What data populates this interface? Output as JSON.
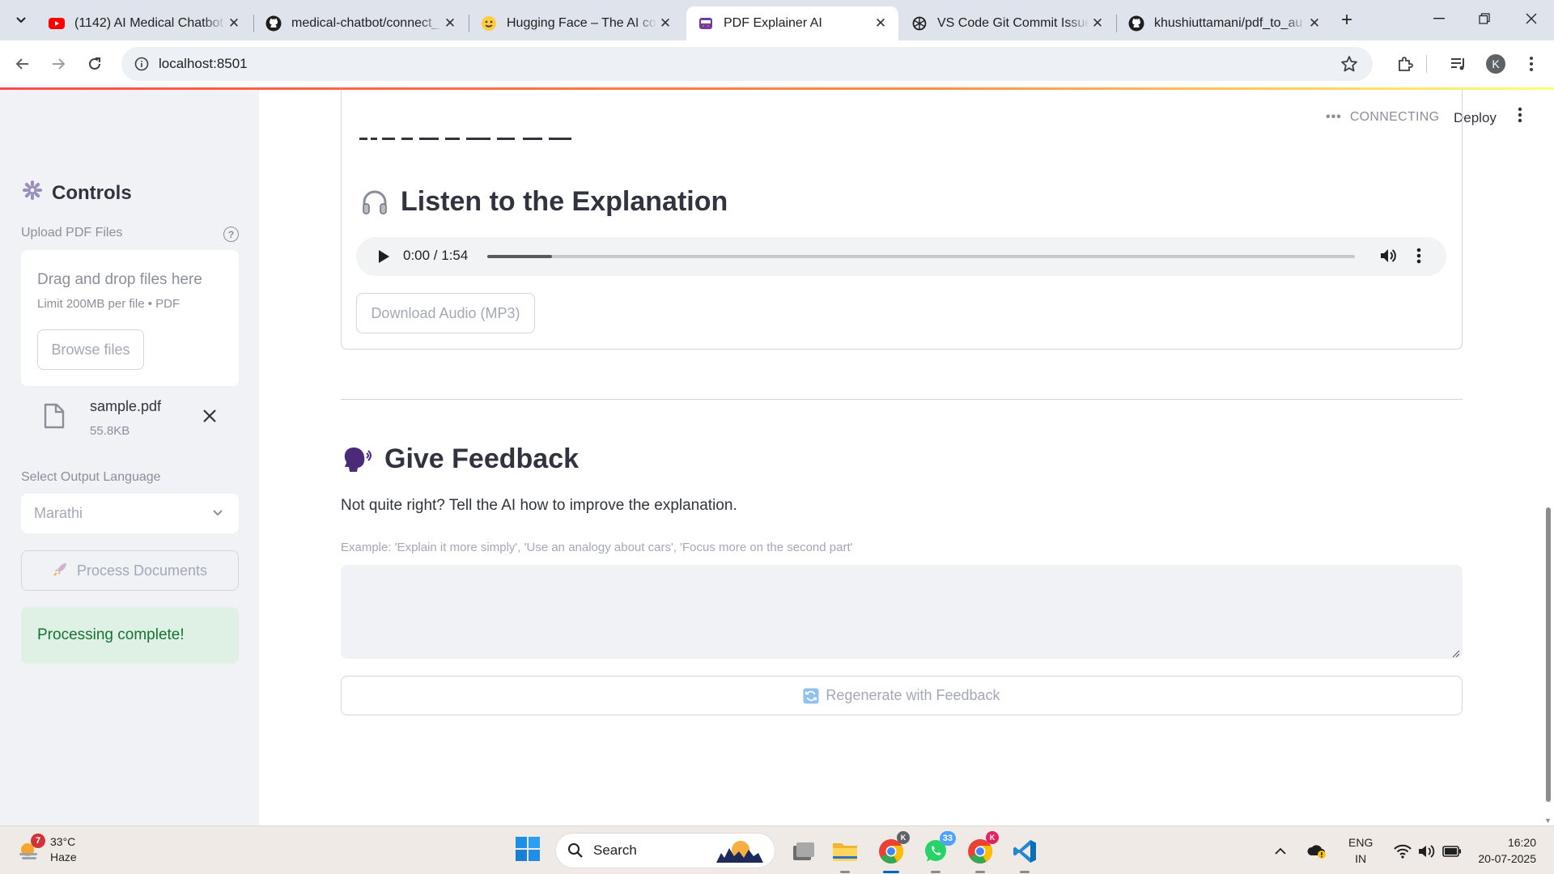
{
  "browser": {
    "tabs": [
      {
        "title": "(1142) AI Medical Chatbot",
        "icon": "youtube-icon"
      },
      {
        "title": "medical-chatbot/connect_",
        "icon": "github-icon"
      },
      {
        "title": "Hugging Face – The AI com",
        "icon": "hugging-face-icon"
      },
      {
        "title": "PDF Explainer AI",
        "icon": "streamlit-icon",
        "active": true
      },
      {
        "title": "VS Code Git Commit Issue",
        "icon": "chatgpt-icon"
      },
      {
        "title": "khushiuttamani/pdf_to_au",
        "icon": "github-icon"
      }
    ],
    "url": "localhost:8501",
    "profile_initial": "K"
  },
  "app_header": {
    "status": "CONNECTING",
    "deploy_label": "Deploy"
  },
  "sidebar": {
    "title": "Controls",
    "upload_label": "Upload PDF Files",
    "dropzone_title": "Drag and drop files here",
    "dropzone_limit": "Limit 200MB per file • PDF",
    "browse_label": "Browse files",
    "file": {
      "name": "sample.pdf",
      "size": "55.8KB"
    },
    "language_label": "Select Output Language",
    "language_value": "Marathi",
    "process_label": "Process Documents",
    "success_message": "Processing complete!"
  },
  "main": {
    "listen_title": "Listen to the Explanation",
    "audio": {
      "time": "0:00 / 1:54",
      "progress": 0.075
    },
    "download_label": "Download Audio (MP3)",
    "feedback_title": "Give Feedback",
    "feedback_intro": "Not quite right? Tell the AI how to improve the explanation.",
    "feedback_hint": "Example: 'Explain it more simply', 'Use an analogy about cars', 'Focus more on the second part'",
    "regenerate_label": "Regenerate with Feedback"
  },
  "taskbar": {
    "weather_temp": "33°C",
    "weather_cond": "Haze",
    "weather_badge": "7",
    "search_label": "Search",
    "whatsapp_badge": "33",
    "lang_primary": "ENG",
    "lang_secondary": "IN",
    "time": "16:20",
    "date": "20-07-2025"
  },
  "colors": {
    "accent_red": "#ff4b4b",
    "success_bg": "#dff0e5",
    "success_text": "#177233",
    "sidebar_bg": "#f0f2f6"
  }
}
